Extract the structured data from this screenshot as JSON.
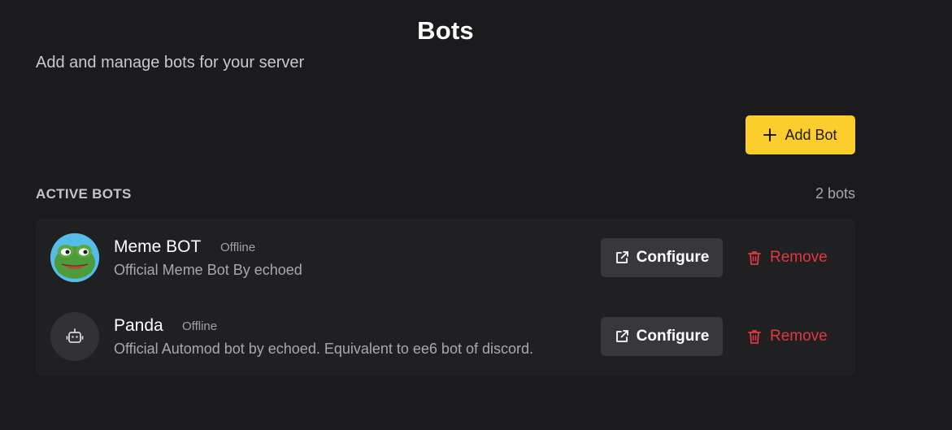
{
  "page": {
    "title": "Bots",
    "subtitle": "Add and manage bots for your server"
  },
  "toolbar": {
    "add_bot_label": "Add Bot",
    "add_bot_icon": "plus-icon"
  },
  "section": {
    "label": "ACTIVE BOTS",
    "count": "2 bots"
  },
  "bots": [
    {
      "name": "Meme BOT",
      "status": "Offline",
      "description": "Official Meme Bot By echoed",
      "avatar": "pepe-frog-avatar",
      "configure_label": "Configure",
      "remove_label": "Remove"
    },
    {
      "name": "Panda",
      "status": "Offline",
      "description": "Official Automod bot by echoed. Equivalent to ee6 bot of discord.",
      "avatar": "robot-icon",
      "configure_label": "Configure",
      "remove_label": "Remove"
    }
  ],
  "colors": {
    "background": "#1b1b1d",
    "panel": "#202023",
    "accent": "#fccd2b",
    "danger": "#e0393e",
    "button": "#38383c"
  }
}
